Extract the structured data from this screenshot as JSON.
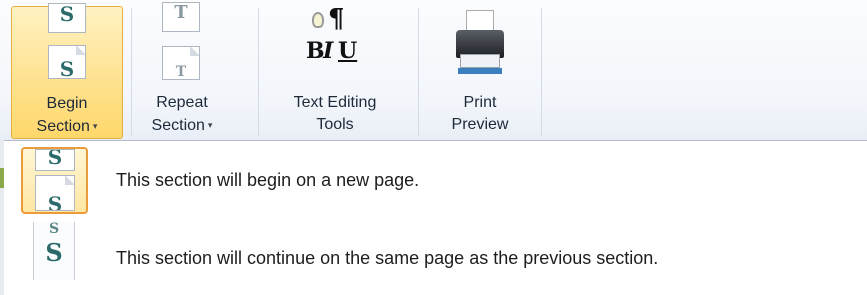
{
  "ribbon": {
    "buttons": [
      {
        "line1": "Begin",
        "line2": "Section",
        "caret": "▾",
        "icon": "begin-section-icon"
      },
      {
        "line1": "Repeat",
        "line2": "Section",
        "caret": "▾",
        "icon": "repeat-section-icon"
      },
      {
        "line1": "Text Editing",
        "line2": "Tools",
        "icon": "text-editing-tools-icon",
        "glyph_bold": "B",
        "glyph_italic": "I",
        "glyph_underline": "U",
        "glyph_pilcrow": "¶"
      },
      {
        "line1": "Print",
        "line2": "Preview",
        "icon": "printer-icon"
      }
    ]
  },
  "dropdown": {
    "items": [
      {
        "text": "This section will begin on a new page.",
        "icon": "new-page-section-icon",
        "selected": true
      },
      {
        "text": "This section will continue on the same page as the previous section.",
        "icon": "same-page-section-icon",
        "selected": false
      }
    ]
  },
  "colors": {
    "selected_border": "#e7b043",
    "selected_fill": "#ffe59a"
  }
}
